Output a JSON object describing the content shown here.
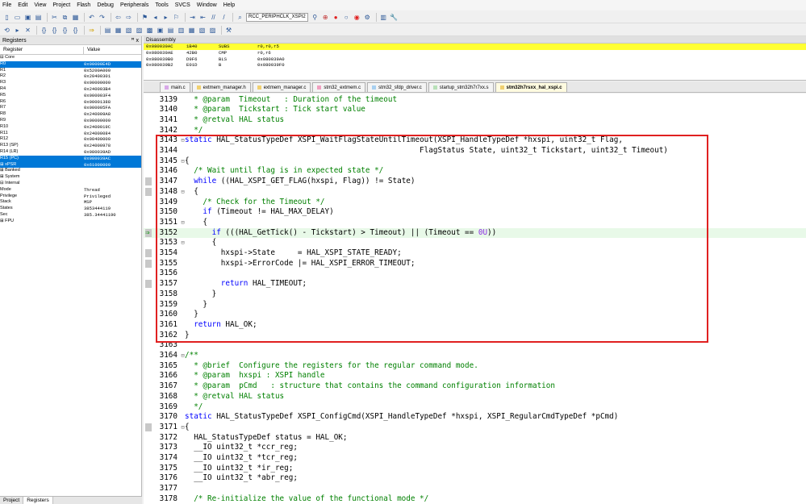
{
  "menubar": {
    "items": [
      "File",
      "Edit",
      "View",
      "Project",
      "Flash",
      "Debug",
      "Peripherals",
      "Tools",
      "SVCS",
      "Window",
      "Help"
    ]
  },
  "toolbar": {
    "target_combo": "RCC_PERIPHCLK_XSPI2"
  },
  "registers_panel": {
    "title": "Registers",
    "pin_close": "ꟸ x",
    "columns": [
      "Register",
      "Value"
    ],
    "rows": [
      {
        "name": "⊟ Core",
        "value": "",
        "sel": false
      },
      {
        "name": "      R0",
        "value": "0x00000E4D",
        "sel": true
      },
      {
        "name": "      R1",
        "value": "0x5200A000",
        "sel": false
      },
      {
        "name": "      R2",
        "value": "0x20400301",
        "sel": false
      },
      {
        "name": "      R3",
        "value": "0x00000000",
        "sel": false
      },
      {
        "name": "      R4",
        "value": "0x240003B4",
        "sel": false
      },
      {
        "name": "      R5",
        "value": "0x000003F4",
        "sel": false
      },
      {
        "name": "      R6",
        "value": "0x00001388",
        "sel": false
      },
      {
        "name": "      R7",
        "value": "0x000005FA",
        "sel": false
      },
      {
        "name": "      R8",
        "value": "0x240009A8",
        "sel": false
      },
      {
        "name": "      R9",
        "value": "0x00000000",
        "sel": false
      },
      {
        "name": "      R10",
        "value": "0x2400019C",
        "sel": false
      },
      {
        "name": "      R11",
        "value": "0x24000084",
        "sel": false
      },
      {
        "name": "      R12",
        "value": "0x00400000",
        "sel": false
      },
      {
        "name": "      R13 (SP)",
        "value": "0x24000978",
        "sel": false
      },
      {
        "name": "      R14 (LR)",
        "value": "0x080039AD",
        "sel": false
      },
      {
        "name": "      R15 (PC)",
        "value": "0x080039AC",
        "sel": true
      },
      {
        "name": "  ⊞ xPSR",
        "value": "0x61000000",
        "sel": true
      },
      {
        "name": "⊞ Banked",
        "value": "",
        "sel": false
      },
      {
        "name": "⊞ System",
        "value": "",
        "sel": false
      },
      {
        "name": "⊟ Internal",
        "value": "",
        "sel": false
      },
      {
        "name": "      Mode",
        "value": "Thread",
        "sel": false
      },
      {
        "name": "      Privilege",
        "value": "Privileged",
        "sel": false
      },
      {
        "name": "      Stack",
        "value": "MSP",
        "sel": false
      },
      {
        "name": "      States",
        "value": "3853444119",
        "sel": false
      },
      {
        "name": "      Sec",
        "value": "385.34441190",
        "sel": false
      },
      {
        "name": "⊞ FPU",
        "value": "",
        "sel": false
      }
    ],
    "tabs": [
      "Project",
      "Registers"
    ]
  },
  "disassembly": {
    "title": "Disassembly",
    "rows": [
      {
        "addr": "0x080039AC",
        "hex": "1B40",
        "op": "SUBS",
        "args": "r0,r0,r5",
        "cur": true
      },
      {
        "addr": "0x080039AE",
        "hex": "42B0",
        "op": "CMP",
        "args": "r0,r6",
        "cur": false
      },
      {
        "addr": "0x080039B0",
        "hex": "D9F6",
        "op": "BLS",
        "args": "0x080039A0",
        "cur": false
      },
      {
        "addr": "0x080039B2",
        "hex": "E01D",
        "op": "B",
        "args": "0x080039F0",
        "cur": false
      }
    ]
  },
  "file_tabs": [
    {
      "label": "main.c",
      "active": false,
      "color": "#d8a8e8"
    },
    {
      "label": "extmem_manager.h",
      "active": false,
      "color": "#f0d070"
    },
    {
      "label": "extmem_manager.c",
      "active": false,
      "color": "#f0d070"
    },
    {
      "label": "stm32_extmem.c",
      "active": false,
      "color": "#f0a0c0"
    },
    {
      "label": "stm32_sfdp_driver.c",
      "active": false,
      "color": "#a8d0f0"
    },
    {
      "label": "startup_stm32h7r7xx.s",
      "active": false,
      "color": "#b8e0b8"
    },
    {
      "label": "stm32h7rsxx_hal_xspi.c",
      "active": true,
      "color": "#f0d070"
    }
  ],
  "code_lines": [
    {
      "n": "3139",
      "f": "",
      "t": "  * @param  Timeout   : Duration of the timeout",
      "c": "com",
      "bp": false,
      "arrow": false,
      "hl": false
    },
    {
      "n": "3140",
      "f": "",
      "t": "  * @param  Tickstart : Tick start value",
      "c": "com",
      "bp": false,
      "arrow": false,
      "hl": false
    },
    {
      "n": "3141",
      "f": "",
      "t": "  * @retval HAL status",
      "c": "com",
      "bp": false,
      "arrow": false,
      "hl": false
    },
    {
      "n": "3142",
      "f": "",
      "t": "  */",
      "c": "com",
      "bp": false,
      "arrow": false,
      "hl": false
    },
    {
      "n": "3143",
      "f": "⊟",
      "t": "static HAL_StatusTypeDef XSPI_WaitFlagStateUntilTimeout(XSPI_HandleTypeDef *hxspi, uint32_t Flag,",
      "c": "",
      "bp": false,
      "arrow": false,
      "hl": false
    },
    {
      "n": "3144",
      "f": "",
      "t": "                                                    FlagStatus State, uint32_t Tickstart, uint32_t Timeout)",
      "c": "",
      "bp": false,
      "arrow": false,
      "hl": false
    },
    {
      "n": "3145",
      "f": "⊟",
      "t": "{",
      "c": "",
      "bp": false,
      "arrow": false,
      "hl": false
    },
    {
      "n": "3146",
      "f": "",
      "t": "  /* Wait until flag is in expected state */",
      "c": "com",
      "bp": false,
      "arrow": false,
      "hl": false
    },
    {
      "n": "3147",
      "f": "",
      "t": "  while ((HAL_XSPI_GET_FLAG(hxspi, Flag)) != State)",
      "c": "",
      "bp": true,
      "arrow": false,
      "hl": false
    },
    {
      "n": "3148",
      "f": "⊟",
      "t": "  {",
      "c": "",
      "bp": true,
      "arrow": false,
      "hl": false
    },
    {
      "n": "3149",
      "f": "",
      "t": "    /* Check for the Timeout */",
      "c": "com",
      "bp": false,
      "arrow": false,
      "hl": false
    },
    {
      "n": "3150",
      "f": "",
      "t": "    if (Timeout != HAL_MAX_DELAY)",
      "c": "",
      "bp": false,
      "arrow": false,
      "hl": false
    },
    {
      "n": "3151",
      "f": "⊟",
      "t": "    {",
      "c": "",
      "bp": false,
      "arrow": false,
      "hl": false
    },
    {
      "n": "3152",
      "f": "",
      "t": "      if (((HAL_GetTick() - Tickstart) > Timeout) || (Timeout == 0U))",
      "c": "",
      "bp": true,
      "arrow": true,
      "hl": true
    },
    {
      "n": "3153",
      "f": "⊟",
      "t": "      {",
      "c": "",
      "bp": false,
      "arrow": false,
      "hl": false
    },
    {
      "n": "3154",
      "f": "",
      "t": "        hxspi->State     = HAL_XSPI_STATE_READY;",
      "c": "",
      "bp": true,
      "arrow": false,
      "hl": false
    },
    {
      "n": "3155",
      "f": "",
      "t": "        hxspi->ErrorCode |= HAL_XSPI_ERROR_TIMEOUT;",
      "c": "",
      "bp": true,
      "arrow": false,
      "hl": false
    },
    {
      "n": "3156",
      "f": "",
      "t": "",
      "c": "",
      "bp": false,
      "arrow": false,
      "hl": false
    },
    {
      "n": "3157",
      "f": "",
      "t": "        return HAL_TIMEOUT;",
      "c": "",
      "bp": true,
      "arrow": false,
      "hl": false
    },
    {
      "n": "3158",
      "f": "",
      "t": "      }",
      "c": "",
      "bp": false,
      "arrow": false,
      "hl": false
    },
    {
      "n": "3159",
      "f": "",
      "t": "    }",
      "c": "",
      "bp": false,
      "arrow": false,
      "hl": false
    },
    {
      "n": "3160",
      "f": "",
      "t": "  }",
      "c": "",
      "bp": false,
      "arrow": false,
      "hl": false
    },
    {
      "n": "3161",
      "f": "",
      "t": "  return HAL_OK;",
      "c": "",
      "bp": false,
      "arrow": false,
      "hl": false
    },
    {
      "n": "3162",
      "f": "",
      "t": "}",
      "c": "",
      "bp": false,
      "arrow": false,
      "hl": false
    },
    {
      "n": "3163",
      "f": "",
      "t": "",
      "c": "",
      "bp": false,
      "arrow": false,
      "hl": false
    },
    {
      "n": "3164",
      "f": "⊟",
      "t": "/**",
      "c": "com",
      "bp": false,
      "arrow": false,
      "hl": false
    },
    {
      "n": "3165",
      "f": "",
      "t": "  * @brief  Configure the registers for the regular command mode.",
      "c": "com",
      "bp": false,
      "arrow": false,
      "hl": false
    },
    {
      "n": "3166",
      "f": "",
      "t": "  * @param  hxspi : XSPI handle",
      "c": "com",
      "bp": false,
      "arrow": false,
      "hl": false
    },
    {
      "n": "3167",
      "f": "",
      "t": "  * @param  pCmd   : structure that contains the command configuration information",
      "c": "com",
      "bp": false,
      "arrow": false,
      "hl": false
    },
    {
      "n": "3168",
      "f": "",
      "t": "  * @retval HAL status",
      "c": "com",
      "bp": false,
      "arrow": false,
      "hl": false
    },
    {
      "n": "3169",
      "f": "",
      "t": "  */",
      "c": "com",
      "bp": false,
      "arrow": false,
      "hl": false
    },
    {
      "n": "3170",
      "f": "",
      "t": "static HAL_StatusTypeDef XSPI_ConfigCmd(XSPI_HandleTypeDef *hxspi, XSPI_RegularCmdTypeDef *pCmd)",
      "c": "",
      "bp": false,
      "arrow": false,
      "hl": false
    },
    {
      "n": "3171",
      "f": "⊟",
      "t": "{",
      "c": "",
      "bp": true,
      "arrow": false,
      "hl": false
    },
    {
      "n": "3172",
      "f": "",
      "t": "  HAL_StatusTypeDef status = HAL_OK;",
      "c": "",
      "bp": false,
      "arrow": false,
      "hl": false
    },
    {
      "n": "3173",
      "f": "",
      "t": "  __IO uint32_t *ccr_reg;",
      "c": "",
      "bp": false,
      "arrow": false,
      "hl": false
    },
    {
      "n": "3174",
      "f": "",
      "t": "  __IO uint32_t *tcr_reg;",
      "c": "",
      "bp": false,
      "arrow": false,
      "hl": false
    },
    {
      "n": "3175",
      "f": "",
      "t": "  __IO uint32_t *ir_reg;",
      "c": "",
      "bp": false,
      "arrow": false,
      "hl": false
    },
    {
      "n": "3176",
      "f": "",
      "t": "  __IO uint32_t *abr_reg;",
      "c": "",
      "bp": false,
      "arrow": false,
      "hl": false
    },
    {
      "n": "3177",
      "f": "",
      "t": "",
      "c": "",
      "bp": false,
      "arrow": false,
      "hl": false
    },
    {
      "n": "3178",
      "f": "",
      "t": "  /* Re-initialize the value of the functional mode */",
      "c": "com",
      "bp": false,
      "arrow": false,
      "hl": false
    }
  ]
}
